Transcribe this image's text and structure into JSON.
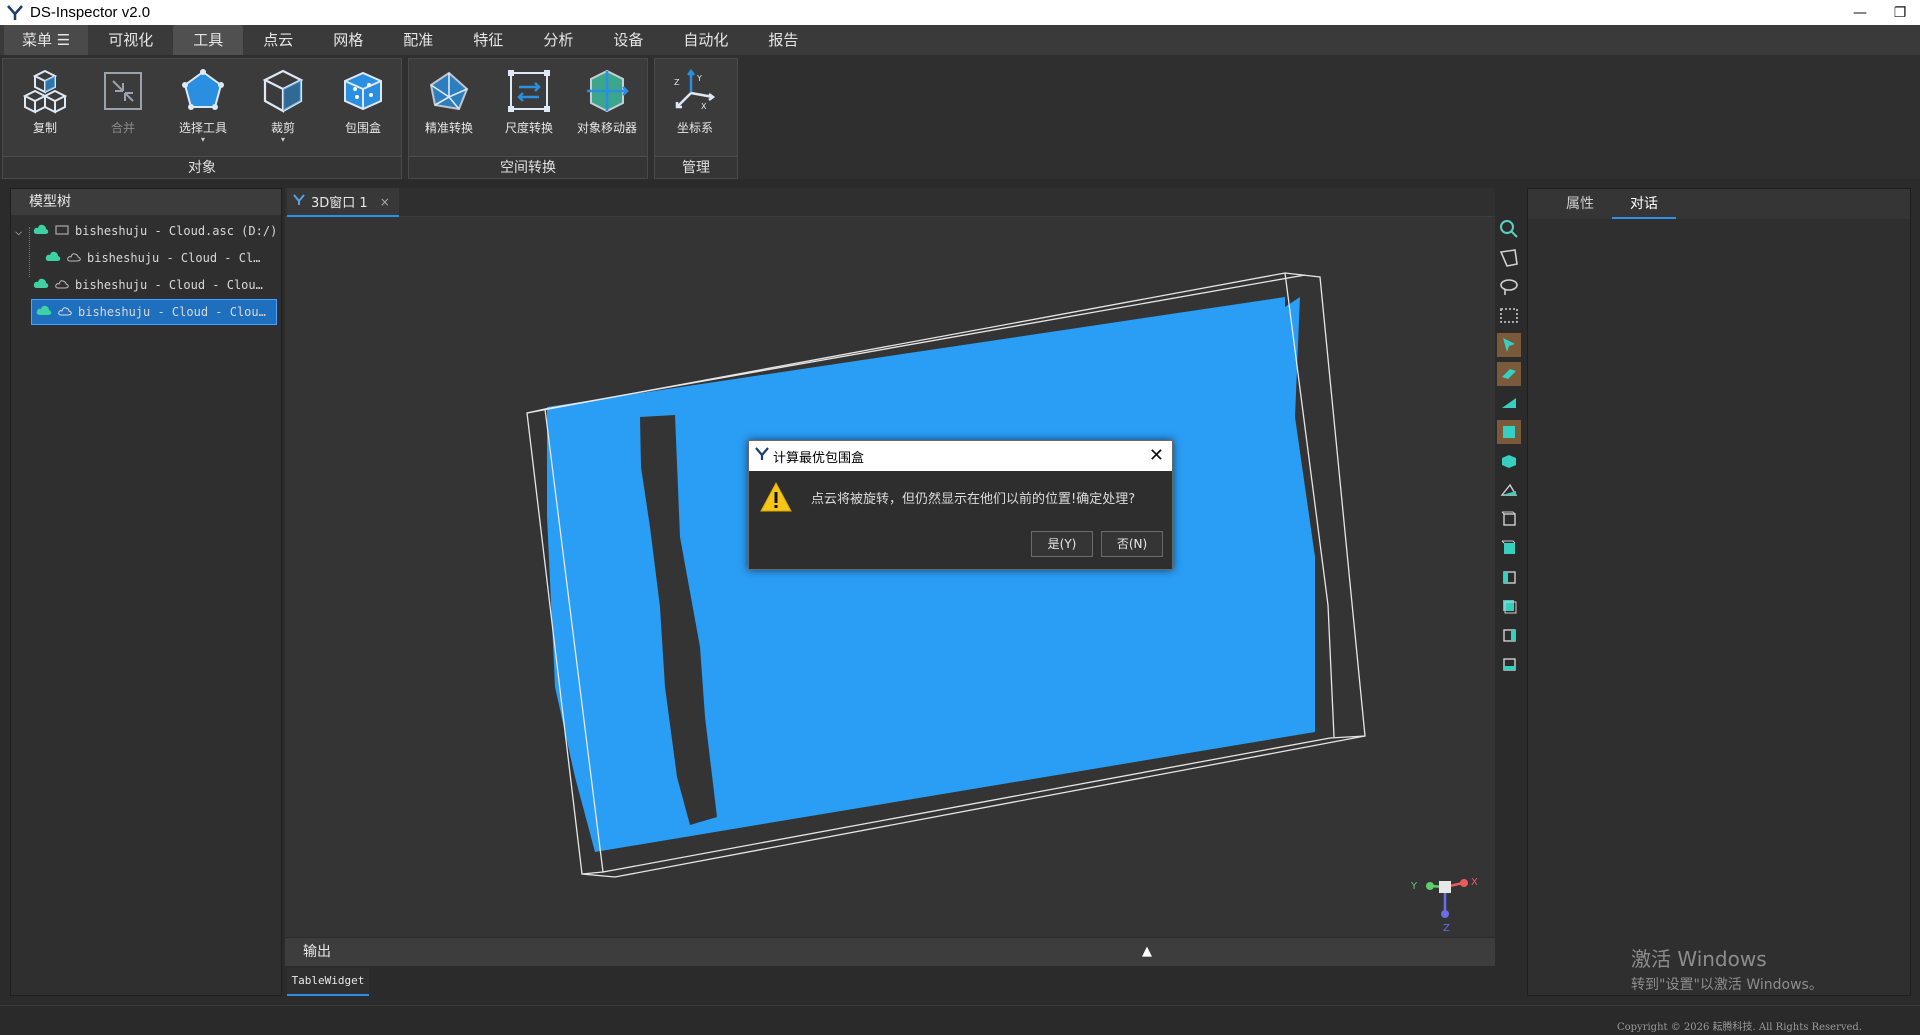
{
  "app": {
    "title": "DS-Inspector v2.0"
  },
  "menubar": {
    "menu_label": "菜单 ☰",
    "items": [
      "可视化",
      "工具",
      "点云",
      "网格",
      "配准",
      "特征",
      "分析",
      "设备",
      "自动化",
      "报告"
    ],
    "active": "工具"
  },
  "ribbon": {
    "groups": [
      {
        "label": "对象",
        "buttons": [
          "复制",
          "合并",
          "选择工具",
          "裁剪",
          "包围盒"
        ]
      },
      {
        "label": "空间转换",
        "buttons": [
          "精准转换",
          "尺度转换",
          "对象移动器"
        ]
      },
      {
        "label": "管理",
        "buttons": [
          "坐标系"
        ]
      }
    ],
    "disabled_buttons": [
      "合并"
    ]
  },
  "model_tree": {
    "title": "模型树",
    "items": [
      {
        "label": "bisheshuju - Cloud.asc (D:/)",
        "level": 0,
        "expanded": true,
        "selected": false
      },
      {
        "label": "bisheshuju - Cloud - Cl…",
        "level": 1,
        "selected": false
      },
      {
        "label": "bisheshuju - Cloud - Clou…",
        "level": 0,
        "selected": false
      },
      {
        "label": "bisheshuju - Cloud - Clou…",
        "level": 0,
        "selected": true
      }
    ]
  },
  "viewport": {
    "tab_label": "3D窗口 1",
    "tab_close": "×",
    "axis_labels": {
      "x": "X",
      "y": "Y",
      "z": "Z"
    },
    "cloud_color": "#2a9df4"
  },
  "right_panel": {
    "tabs": [
      "属性",
      "对话"
    ],
    "active": "对话"
  },
  "output": {
    "title": "输出",
    "toggle": "▲",
    "tab_label": "TableWidget"
  },
  "dialog": {
    "title": "计算最优包围盒",
    "message": "点云将被旋转，但仍然显示在他们以前的位置!确定处理?",
    "yes_label": "是(Y)",
    "no_label": "否(N)",
    "close": "✕"
  },
  "watermark": {
    "line1": "激活 Windows",
    "line2": "转到\"设置\"以激活 Windows。"
  },
  "status": {
    "copyright": "Copyright © 2026 耘腾科技. All Rights Reserved."
  },
  "window_controls": {
    "minimize": "—",
    "restore": "❐"
  }
}
